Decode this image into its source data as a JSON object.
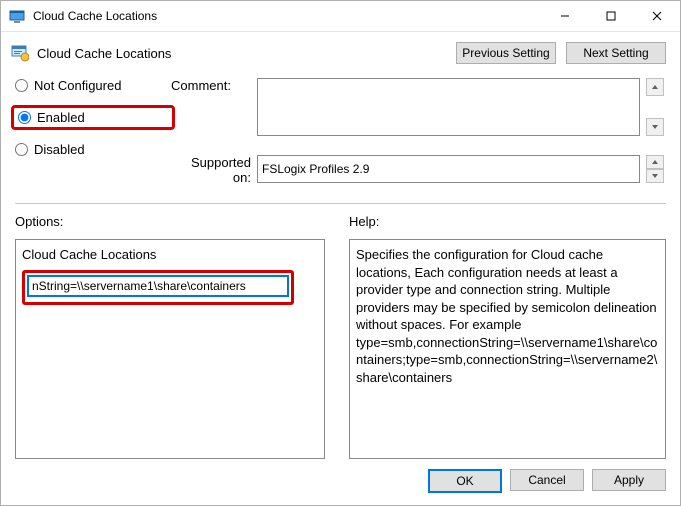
{
  "window": {
    "title": "Cloud Cache Locations"
  },
  "header": {
    "title": "Cloud Cache Locations",
    "prev": "Previous Setting",
    "next": "Next Setting"
  },
  "state": {
    "not_configured": "Not Configured",
    "enabled": "Enabled",
    "disabled": "Disabled"
  },
  "labels": {
    "comment": "Comment:",
    "supported": "Supported on:",
    "options": "Options:",
    "help": "Help:"
  },
  "values": {
    "comment": "",
    "supported": "FSLogix Profiles 2.9"
  },
  "options": {
    "field_label": "Cloud Cache Locations",
    "field_value": "nString=\\\\servername1\\share\\containers"
  },
  "help": {
    "text": "Specifies the configuration for Cloud cache locations, Each configuration needs at least a provider type and connection string. Multiple providers may be specified by semicolon delineation without spaces. For example type=smb,connectionString=\\\\servername1\\share\\containers;type=smb,connectionString=\\\\servername2\\share\\containers"
  },
  "buttons": {
    "ok": "OK",
    "cancel": "Cancel",
    "apply": "Apply"
  }
}
